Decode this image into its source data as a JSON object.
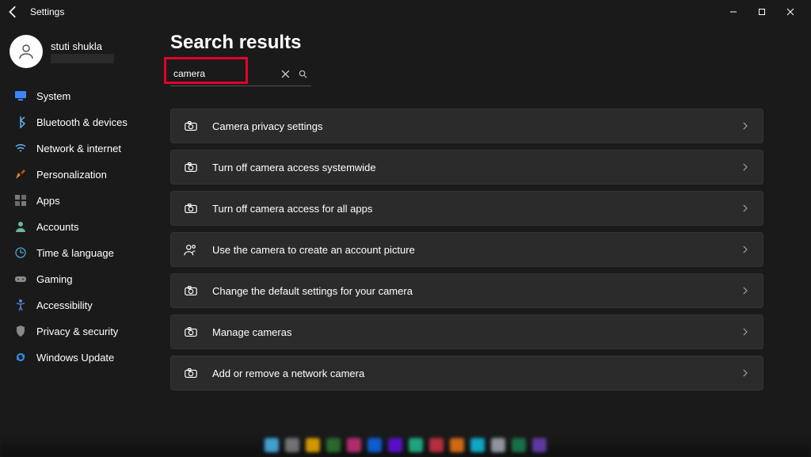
{
  "window": {
    "title": "Settings"
  },
  "profile": {
    "name": "stuti shukla"
  },
  "sidebar": {
    "items": [
      {
        "label": "System",
        "icon": "system"
      },
      {
        "label": "Bluetooth & devices",
        "icon": "bluetooth"
      },
      {
        "label": "Network & internet",
        "icon": "network"
      },
      {
        "label": "Personalization",
        "icon": "personalization"
      },
      {
        "label": "Apps",
        "icon": "apps"
      },
      {
        "label": "Accounts",
        "icon": "accounts"
      },
      {
        "label": "Time & language",
        "icon": "timelang"
      },
      {
        "label": "Gaming",
        "icon": "gaming"
      },
      {
        "label": "Accessibility",
        "icon": "accessibility"
      },
      {
        "label": "Privacy & security",
        "icon": "privacy"
      },
      {
        "label": "Windows Update",
        "icon": "update"
      }
    ]
  },
  "main": {
    "title": "Search results",
    "search_value": "camera",
    "results": [
      {
        "label": "Camera privacy settings",
        "icon": "camera"
      },
      {
        "label": "Turn off camera access systemwide",
        "icon": "camera"
      },
      {
        "label": "Turn off camera access for all apps",
        "icon": "camera"
      },
      {
        "label": "Use the camera to create an account picture",
        "icon": "people"
      },
      {
        "label": "Change the default settings for your camera",
        "icon": "camera"
      },
      {
        "label": "Manage cameras",
        "icon": "camera"
      },
      {
        "label": "Add or remove a network camera",
        "icon": "camera"
      }
    ]
  }
}
